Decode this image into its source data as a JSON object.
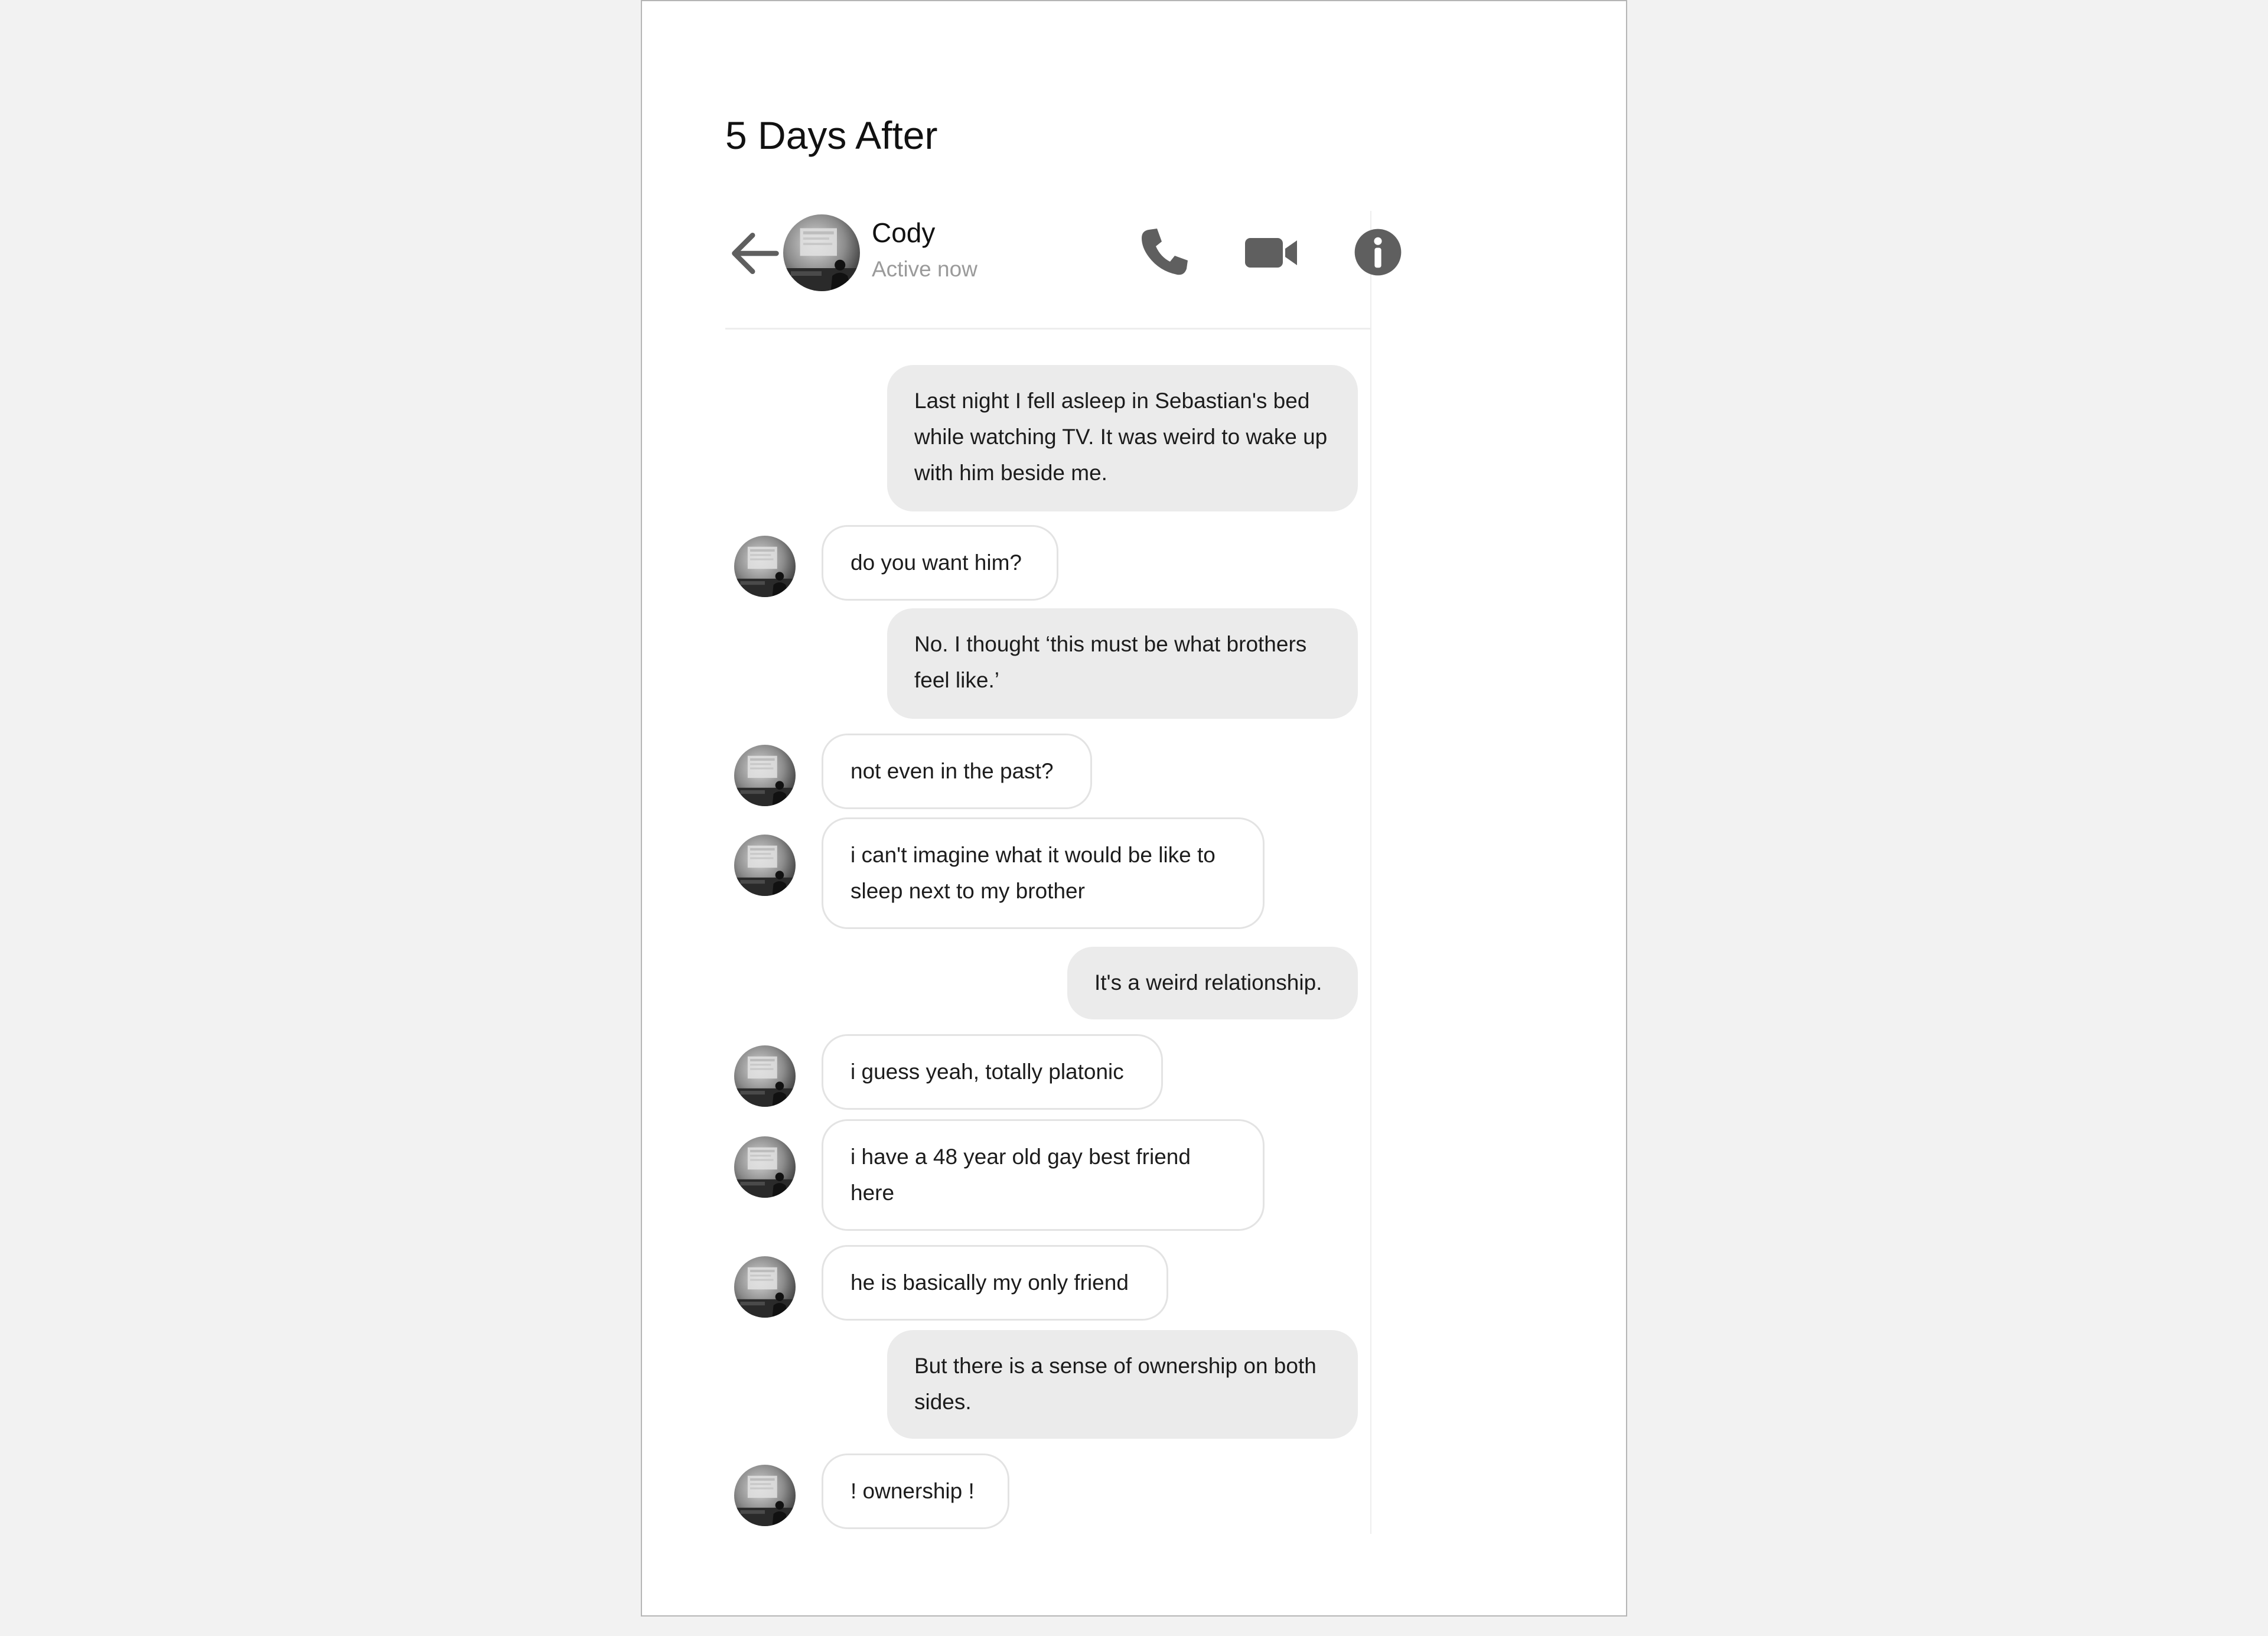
{
  "page": {
    "title": "5 Days After"
  },
  "contact": {
    "name": "Cody",
    "status": "Active now"
  },
  "header": {
    "back_icon": "arrow-left-icon",
    "call_icon": "phone-icon",
    "video_icon": "video-camera-icon",
    "info_icon": "info-icon"
  },
  "colors": {
    "outgoing_bubble": "#ebebeb",
    "incoming_border": "#e3e3e3",
    "icon": "#5f5f5f",
    "status_text": "#9a9a9a"
  },
  "messages": [
    {
      "sender": "me",
      "text": "Last night I fell asleep in Sebastian's bed while watching TV. It was weird to wake up with him beside me."
    },
    {
      "sender": "Cody",
      "text": "do you want him?"
    },
    {
      "sender": "me",
      "text": "No. I thought ‘this must be what brothers feel like.’"
    },
    {
      "sender": "Cody",
      "text": "not even in the past?"
    },
    {
      "sender": "Cody",
      "text": "i can't imagine what it would be like to sleep next to my brother"
    },
    {
      "sender": "me",
      "text": "It's a weird relationship."
    },
    {
      "sender": "Cody",
      "text": "i guess yeah, totally platonic"
    },
    {
      "sender": "Cody",
      "text": "i have a 48 year old gay best friend here"
    },
    {
      "sender": "Cody",
      "text": "he is basically my only friend"
    },
    {
      "sender": "me",
      "text": "But there is a sense of ownership on both sides."
    },
    {
      "sender": "Cody",
      "text": "! ownership !"
    }
  ]
}
